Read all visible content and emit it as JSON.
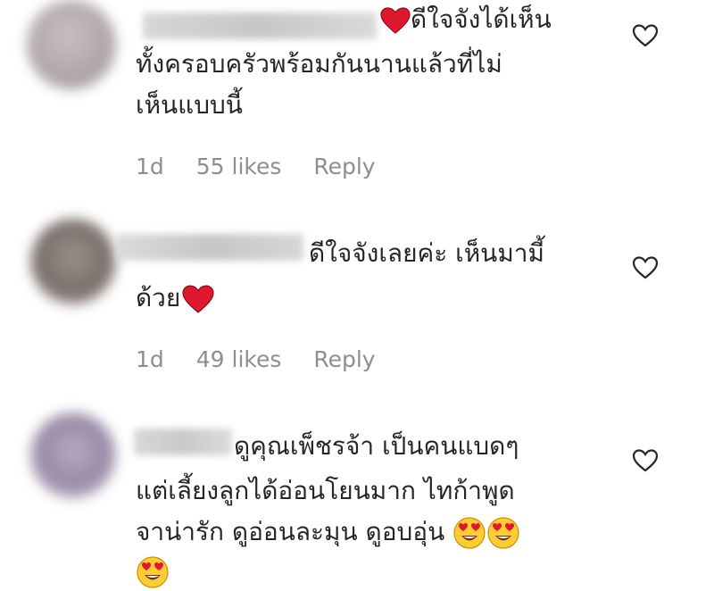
{
  "comments": [
    {
      "lines": [
        "ดีใจจังได้เห็น",
        "ทั้งครอบครัวพร้อมกันนานแล้วที่ไม่",
        "เห็นแบบนี้"
      ],
      "time": "1d",
      "likes": "55 likes",
      "reply": "Reply"
    },
    {
      "lines": [
        "ดีใจจังเลยค่ะ เห็นมามี้",
        "ด้วย"
      ],
      "time": "1d",
      "likes": "49 likes",
      "reply": "Reply"
    },
    {
      "lines": [
        "ดูคุณเพ็ชรจ้า เป็นคนแบดๆ",
        "แต่เลี้ยงลูกได้อ่อนโยนมาก ไทก้าพูด",
        "จาน่ารัก ดูอ่อนละมุน ดูอบอุ่น"
      ]
    }
  ],
  "icons": {
    "like": "heart-outline-icon",
    "red_heart": "red-heart-emoji",
    "heart_eyes": "heart-eyes-emoji"
  },
  "colors": {
    "text": "#262626",
    "meta": "#8e8e8e",
    "heart_red": "#e0182d",
    "emoji_yellow": "#ffcc33"
  }
}
